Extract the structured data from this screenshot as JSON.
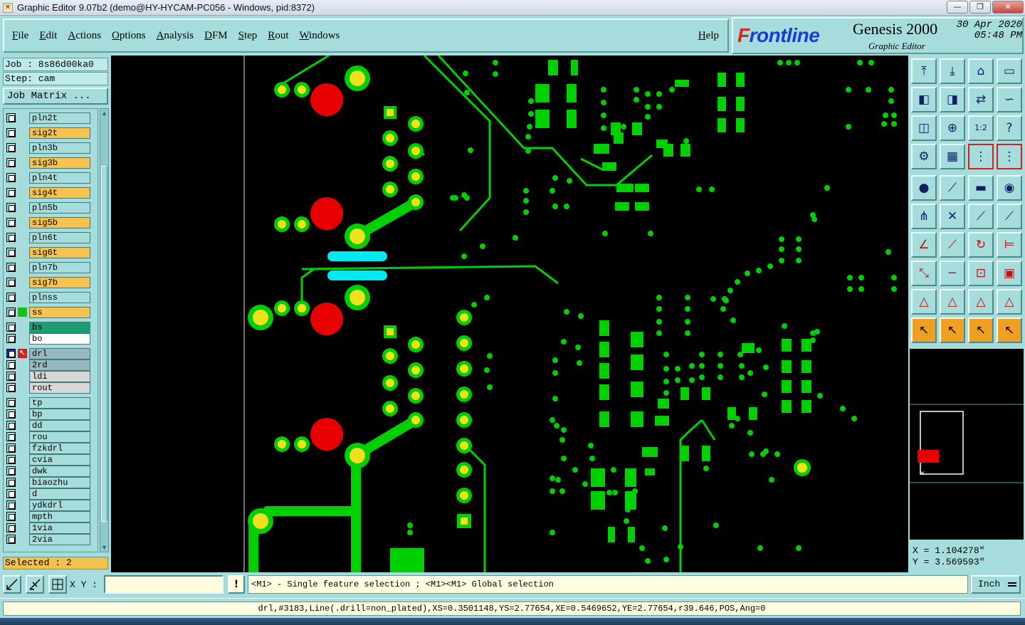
{
  "window": {
    "title": "Graphic Editor 9.07b2 (demo@HY-HYCAM-PC056 - Windows, pid:8372)",
    "minimize_glyph": "—",
    "maximize_glyph": "❐",
    "close_glyph": "✕"
  },
  "menu": {
    "items": [
      "File",
      "Edit",
      "Actions",
      "Options",
      "Analysis",
      "DFM",
      "Step",
      "Rout",
      "Windows"
    ],
    "help": "Help"
  },
  "brand": {
    "logo_prefix": "F",
    "logo_rest": "rontline",
    "product": "Genesis 2000",
    "subtitle": "Graphic Editor",
    "date": "30 Apr 2020",
    "time": "05:48 PM"
  },
  "job": {
    "job_line": "Job : 8s86d00ka0",
    "step_line": "Step: cam",
    "matrix_button": "Job Matrix ..."
  },
  "layers": [
    {
      "name": "pln2t",
      "color": "#a6dcdc"
    },
    {
      "name": "sig2t",
      "color": "#f7c24f"
    },
    {
      "name": "pln3b",
      "color": "#a6dcdc"
    },
    {
      "name": "sig3b",
      "color": "#f7c24f"
    },
    {
      "name": "pln4t",
      "color": "#a6dcdc"
    },
    {
      "name": "sig4t",
      "color": "#f7c24f"
    },
    {
      "name": "pln5b",
      "color": "#a6dcdc"
    },
    {
      "name": "sig5b",
      "color": "#f7c24f"
    },
    {
      "name": "pln6t",
      "color": "#a6dcdc"
    },
    {
      "name": "sig6t",
      "color": "#f7c24f"
    },
    {
      "name": "pln7b",
      "color": "#a6dcdc"
    },
    {
      "name": "sig7b",
      "color": "#f7c24f"
    },
    {
      "name": "plnss",
      "color": "#a6dcdc"
    },
    {
      "name": "ss",
      "color": "#f7c24f",
      "affected": true,
      "swatch": "#18c018"
    },
    {
      "name": "bs",
      "color": "#18a070"
    },
    {
      "name": "bo",
      "color": "#ffffff"
    },
    {
      "name": "drl",
      "color": "#98b8c0",
      "work": true
    },
    {
      "name": "2rd",
      "color": "#98b8c0"
    },
    {
      "name": "ldi",
      "color": "#d8d8d8"
    },
    {
      "name": "rout",
      "color": "#d8d8d8"
    },
    {
      "name": "tp",
      "color": "#a6dcdc"
    },
    {
      "name": "bp",
      "color": "#a6dcdc"
    },
    {
      "name": "dd",
      "color": "#a6dcdc"
    },
    {
      "name": "rou",
      "color": "#a6dcdc"
    },
    {
      "name": "fzkdrl",
      "color": "#a6dcdc"
    },
    {
      "name": "cvia",
      "color": "#a6dcdc"
    },
    {
      "name": "dwk",
      "color": "#a6dcdc"
    },
    {
      "name": "biaozhu",
      "color": "#a6dcdc"
    },
    {
      "name": "d",
      "color": "#a6dcdc"
    },
    {
      "name": "ydkdrl",
      "color": "#a6dcdc"
    },
    {
      "name": "mpth",
      "color": "#a6dcdc"
    },
    {
      "name": "1via",
      "color": "#a6dcdc"
    },
    {
      "name": "2via",
      "color": "#a6dcdc"
    }
  ],
  "selection": {
    "text": "Selected : 2"
  },
  "coordinates": {
    "x_text": "X = 1.104278\"",
    "y_text": "Y = 3.569593\""
  },
  "colors": {
    "panel": "#a6dcdc",
    "copper": "#00d000",
    "pad_yellow": "#f0e020",
    "drill_red": "#e80000",
    "selection_cyan": "#00e8f0"
  },
  "bottom": {
    "xy_label": "X Y :",
    "xy_value": "",
    "warn_glyph": "!",
    "hint": "<M1> - Single feature selection ; <M1><M1> Global selection",
    "units": "Inch"
  },
  "status": {
    "feature_info": "drl,#3183,Line(.drill=non_plated),XS=0.3501148,YS=2.77654,XE=0.5469652,YE=2.77654,r39.646,POS,Ang=0"
  }
}
